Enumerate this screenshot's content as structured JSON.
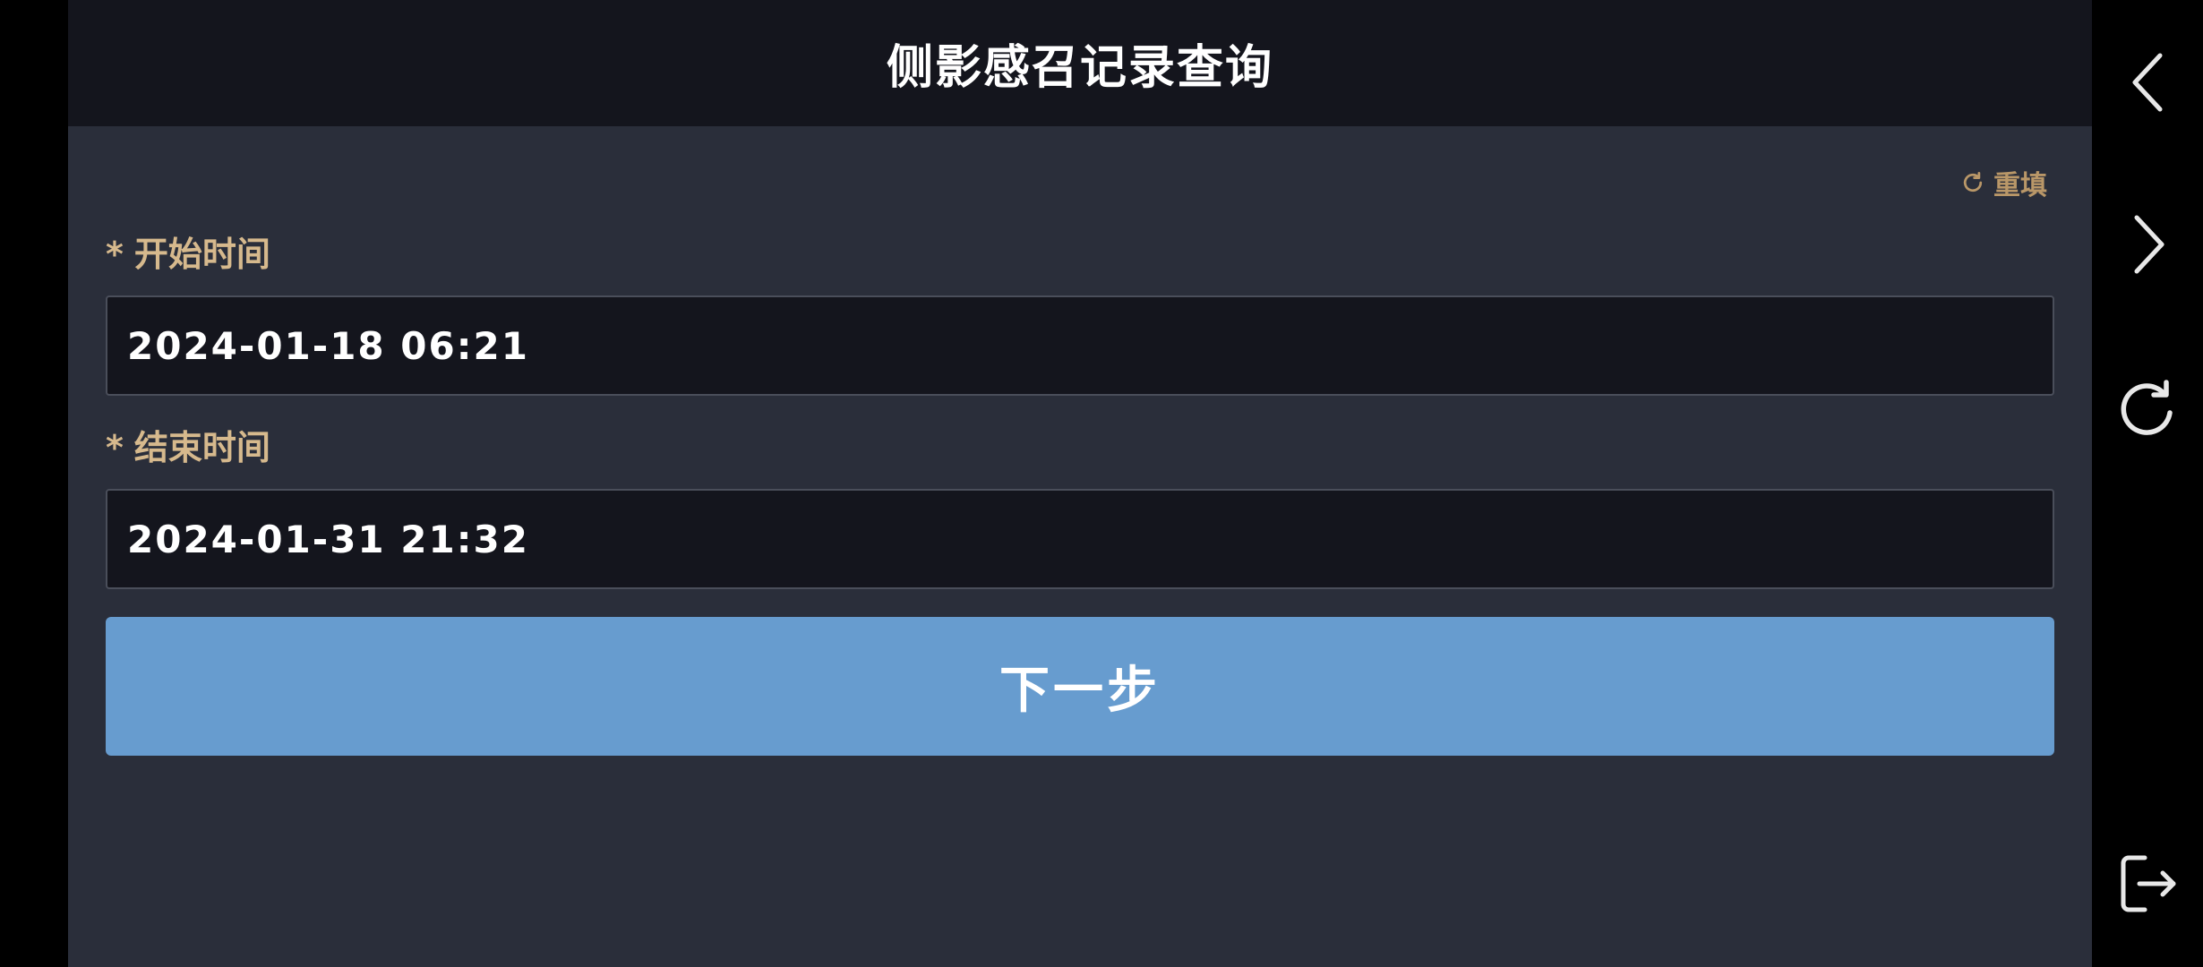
{
  "header": {
    "title": "侧影感召记录查询"
  },
  "form": {
    "reset_label": "重填",
    "start": {
      "required_mark": "*",
      "label": "开始时间",
      "value": "2024-01-18 06:21"
    },
    "end": {
      "required_mark": "*",
      "label": "结束时间",
      "value": "2024-01-31 21:32"
    },
    "next_label": "下一步"
  },
  "icons": {
    "reset": "refresh-icon",
    "back": "chevron-left-icon",
    "forward": "chevron-right-icon",
    "refresh": "refresh-icon",
    "exit": "exit-icon"
  },
  "colors": {
    "header_bg": "#14151d",
    "body_bg": "#2a2e3a",
    "label": "#d6b98d",
    "reset": "#b99768",
    "button": "#679ccf"
  }
}
